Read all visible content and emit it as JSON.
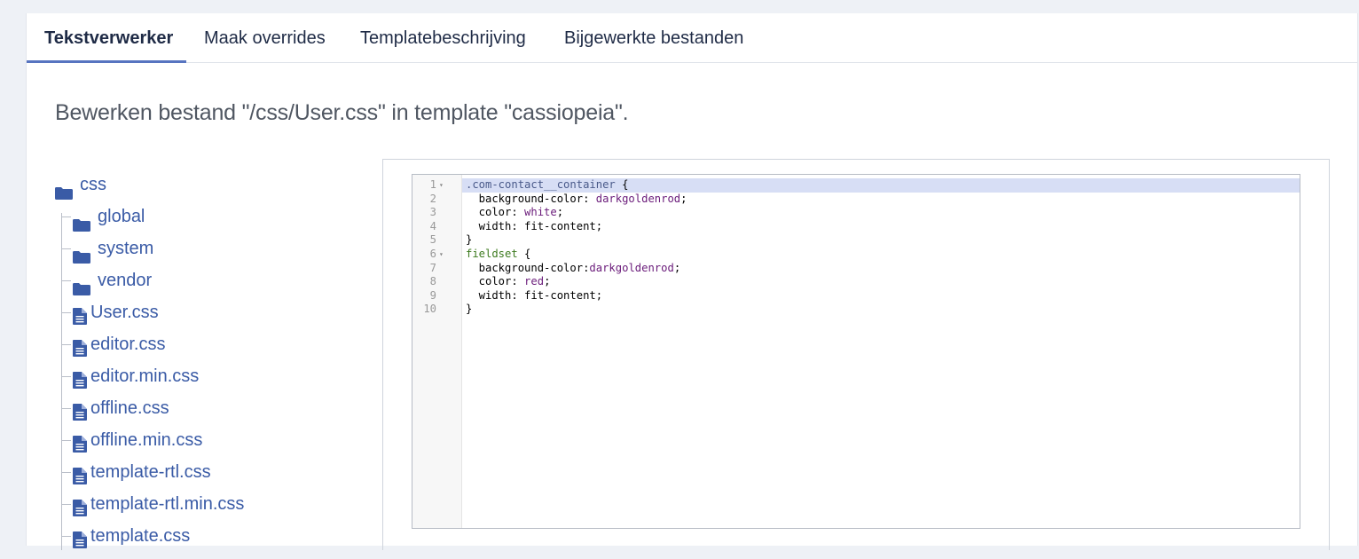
{
  "tabs": [
    {
      "label": "Tekstverwerker",
      "active": true
    },
    {
      "label": "Maak overrides",
      "active": false
    },
    {
      "label": "Templatebeschrijving",
      "active": false
    },
    {
      "label": "Bijgewerkte bestanden",
      "active": false
    }
  ],
  "heading": "Bewerken bestand \"/css/User.css\" in template \"cassiopeia\".",
  "tree": {
    "root": {
      "label": "css",
      "icon": "folder-icon"
    },
    "folders": [
      {
        "label": "global",
        "icon": "folder-icon"
      },
      {
        "label": "system",
        "icon": "folder-icon"
      },
      {
        "label": "vendor",
        "icon": "folder-icon"
      }
    ],
    "files": [
      {
        "label": "User.css",
        "icon": "file-icon"
      },
      {
        "label": "editor.css",
        "icon": "file-icon"
      },
      {
        "label": "editor.min.css",
        "icon": "file-icon"
      },
      {
        "label": "offline.css",
        "icon": "file-icon"
      },
      {
        "label": "offline.min.css",
        "icon": "file-icon"
      },
      {
        "label": "template-rtl.css",
        "icon": "file-icon"
      },
      {
        "label": "template-rtl.min.css",
        "icon": "file-icon"
      },
      {
        "label": "template.css",
        "icon": "file-icon"
      }
    ]
  },
  "editor": {
    "lines": [
      {
        "n": "1",
        "fold": "▾",
        "parts": [
          {
            "t": ".com-contact__container",
            "c": "sel"
          },
          {
            "t": " {",
            "c": "plain"
          }
        ]
      },
      {
        "n": "2",
        "fold": "",
        "parts": [
          {
            "t": "  background-color: ",
            "c": "prop"
          },
          {
            "t": "darkgoldenrod",
            "c": "val"
          },
          {
            "t": ";",
            "c": "plain"
          }
        ]
      },
      {
        "n": "3",
        "fold": "",
        "parts": [
          {
            "t": "  color: ",
            "c": "prop"
          },
          {
            "t": "white",
            "c": "val"
          },
          {
            "t": ";",
            "c": "plain"
          }
        ]
      },
      {
        "n": "4",
        "fold": "",
        "parts": [
          {
            "t": "  width: fit-content;",
            "c": "prop"
          }
        ]
      },
      {
        "n": "5",
        "fold": "",
        "parts": [
          {
            "t": "}",
            "c": "plain"
          }
        ]
      },
      {
        "n": "6",
        "fold": "▾",
        "parts": [
          {
            "t": "fieldset",
            "c": "tag"
          },
          {
            "t": " {",
            "c": "plain"
          }
        ]
      },
      {
        "n": "7",
        "fold": "",
        "parts": [
          {
            "t": "  background-color:",
            "c": "prop"
          },
          {
            "t": "darkgoldenrod",
            "c": "val"
          },
          {
            "t": ";",
            "c": "plain"
          }
        ]
      },
      {
        "n": "8",
        "fold": "",
        "parts": [
          {
            "t": "  color: ",
            "c": "prop"
          },
          {
            "t": "red",
            "c": "val"
          },
          {
            "t": ";",
            "c": "plain"
          }
        ]
      },
      {
        "n": "9",
        "fold": "",
        "parts": [
          {
            "t": "  width: fit-content;",
            "c": "prop"
          }
        ]
      },
      {
        "n": "10",
        "fold": "",
        "parts": [
          {
            "t": "}",
            "c": "plain"
          }
        ]
      }
    ]
  },
  "colors": {
    "accent": "#5774c0",
    "link": "#3a5ba6",
    "active_line": "#d7def5"
  }
}
